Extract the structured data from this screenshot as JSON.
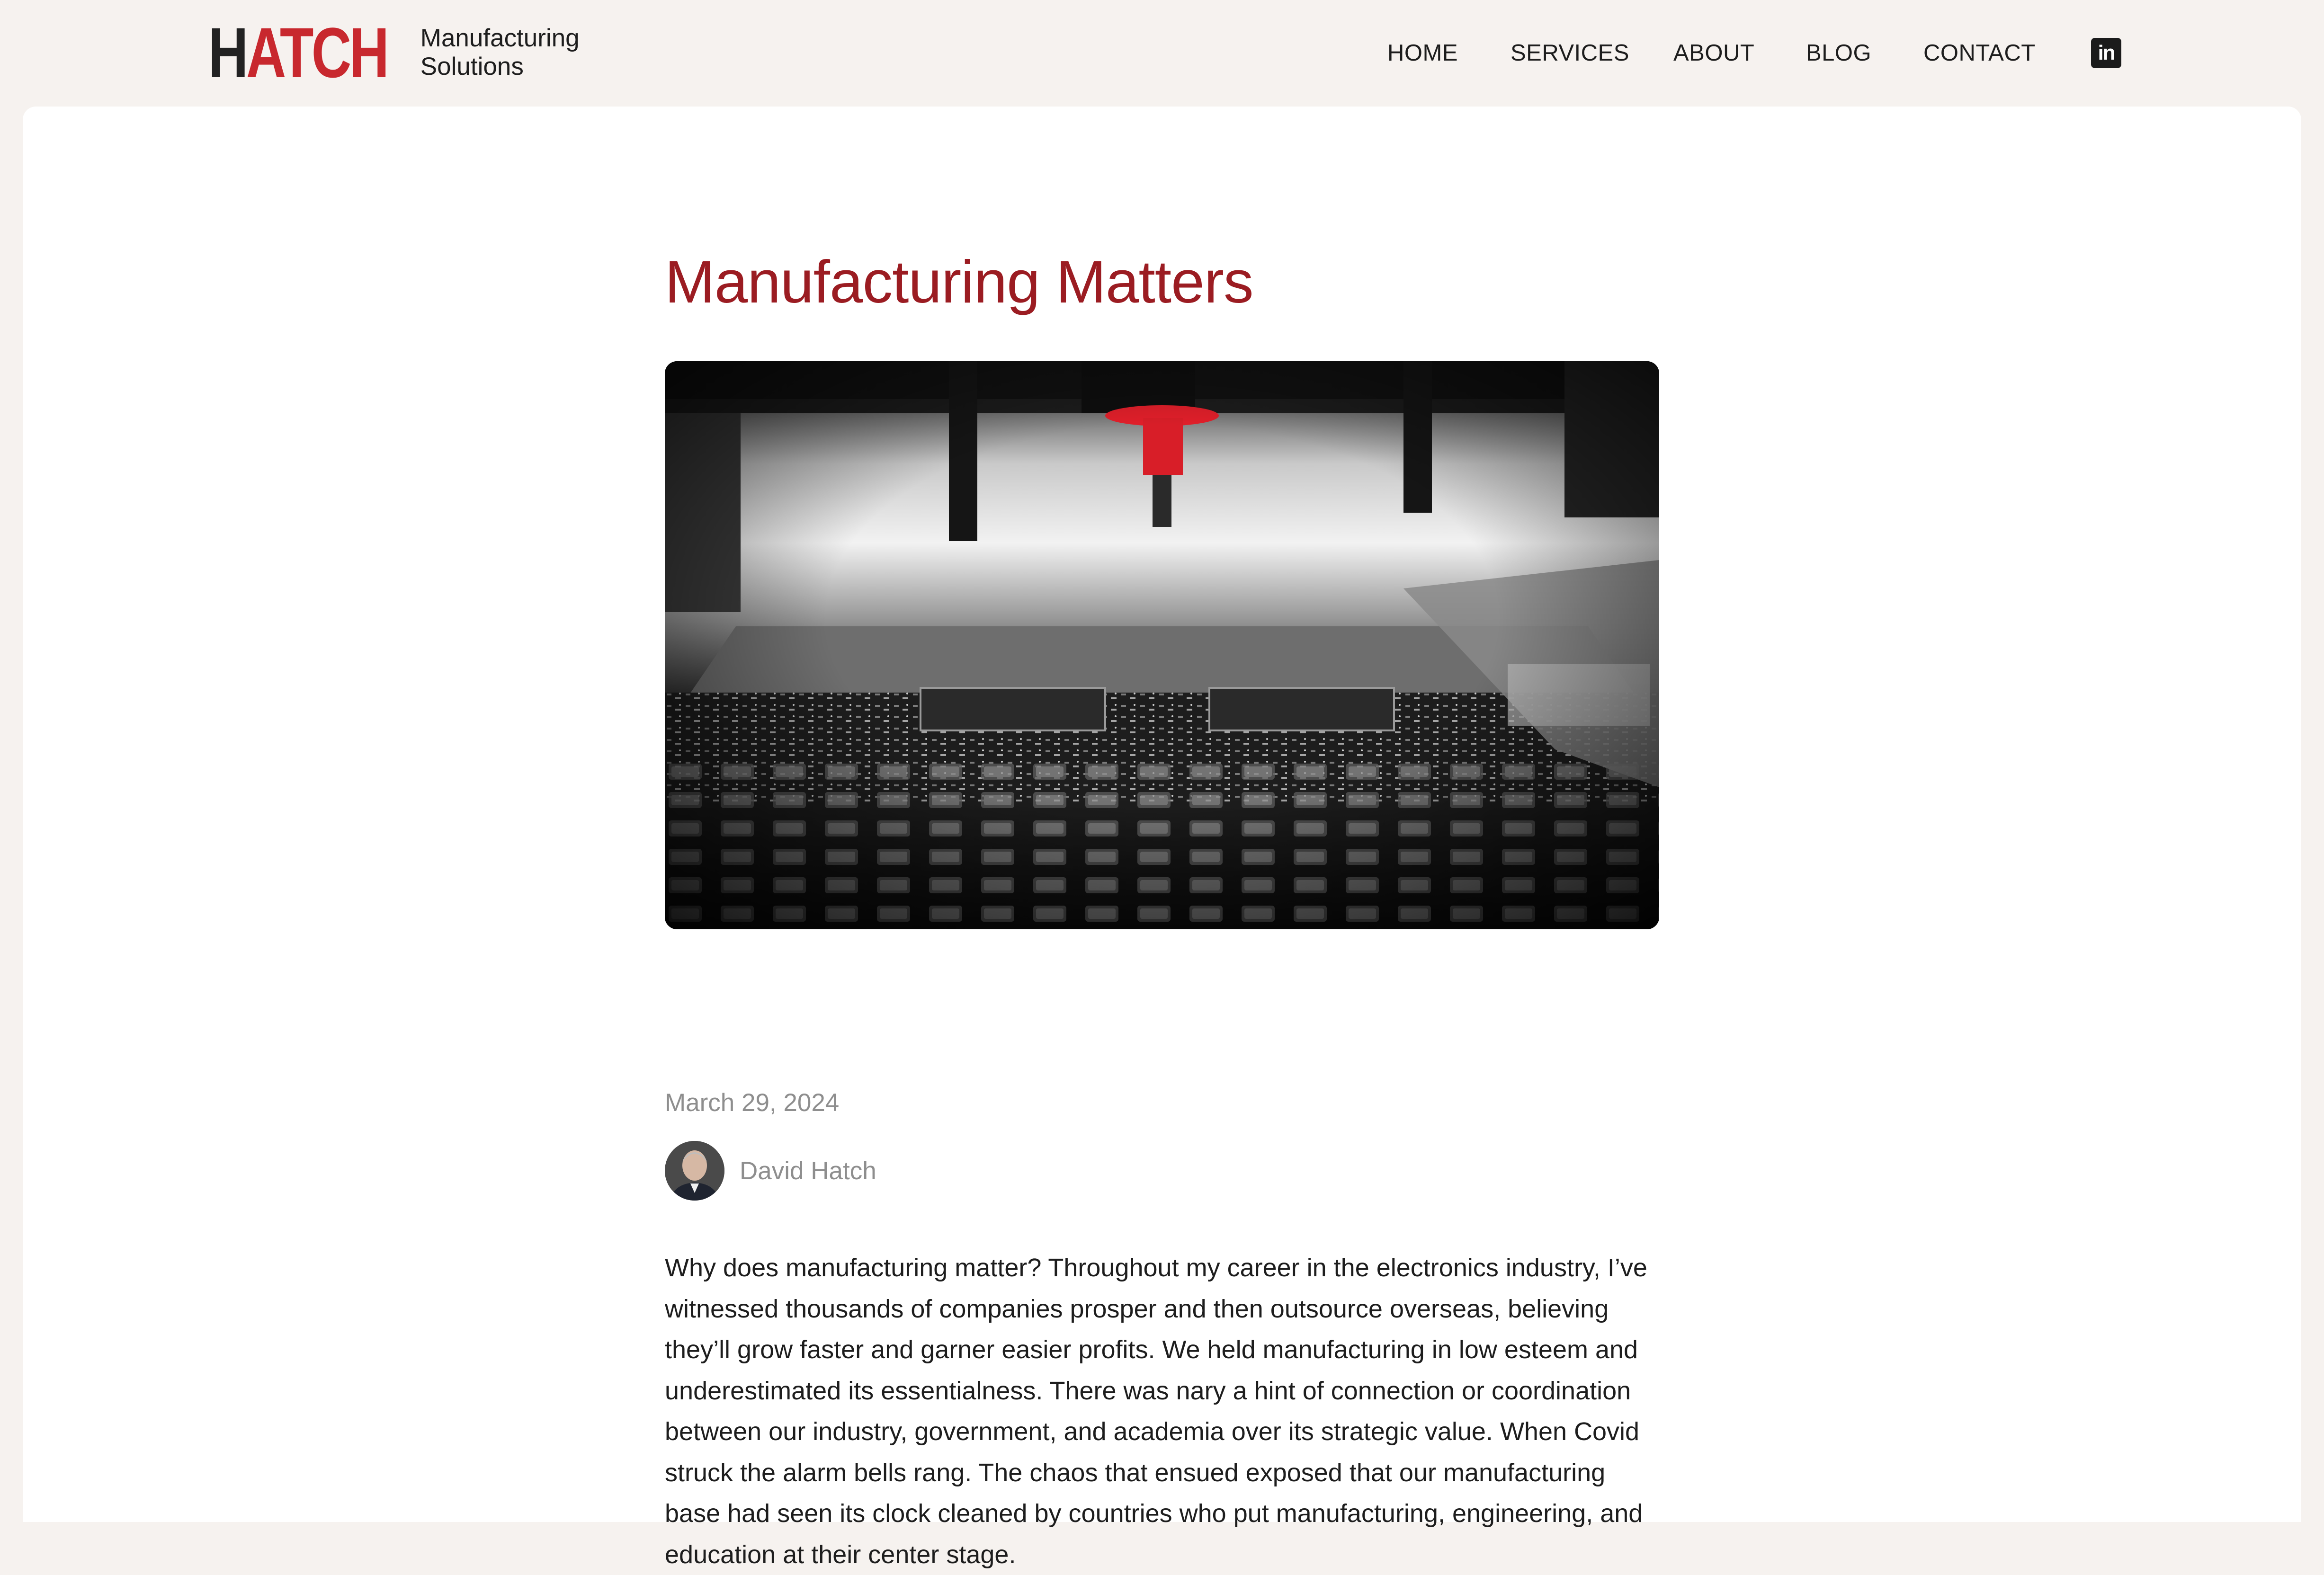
{
  "header": {
    "logo": {
      "mark_first": "H",
      "mark_rest": "ATCH",
      "tagline_line1": "Manufacturing",
      "tagline_line2": "Solutions"
    },
    "nav": [
      {
        "label": "HOME"
      },
      {
        "label": "SERVICES"
      },
      {
        "label": "ABOUT"
      },
      {
        "label": "BLOG"
      },
      {
        "label": "CONTACT"
      }
    ],
    "social": {
      "icon": "linkedin-icon",
      "glyph": "in"
    }
  },
  "post": {
    "title": "Manufacturing Matters",
    "hero_image": "circuit-board-pick-and-place-machine",
    "date": "March 29, 2024",
    "author": "David Hatch",
    "body": "Why does manufacturing matter? Throughout my career in the electronics industry, I’ve witnessed thousands of companies prosper and then outsource overseas, believing they’ll grow faster and garner easier profits. We held manufacturing in low esteem and underestimated its essentialness.  There was nary a hint of connection or coordination between our industry, government, and academia over its strategic value. When Covid struck the alarm bells rang.  The chaos that ensued exposed that our manufacturing base had seen its clock cleaned by countries who put manufacturing, engineering, and education at their center stage."
  },
  "colors": {
    "page_background": "#f6f2ef",
    "card_background": "#ffffff",
    "brand_red": "#c8282e",
    "title_red": "#9b1c22",
    "muted_text": "#8e8e8e",
    "text": "#1d1d1d"
  }
}
